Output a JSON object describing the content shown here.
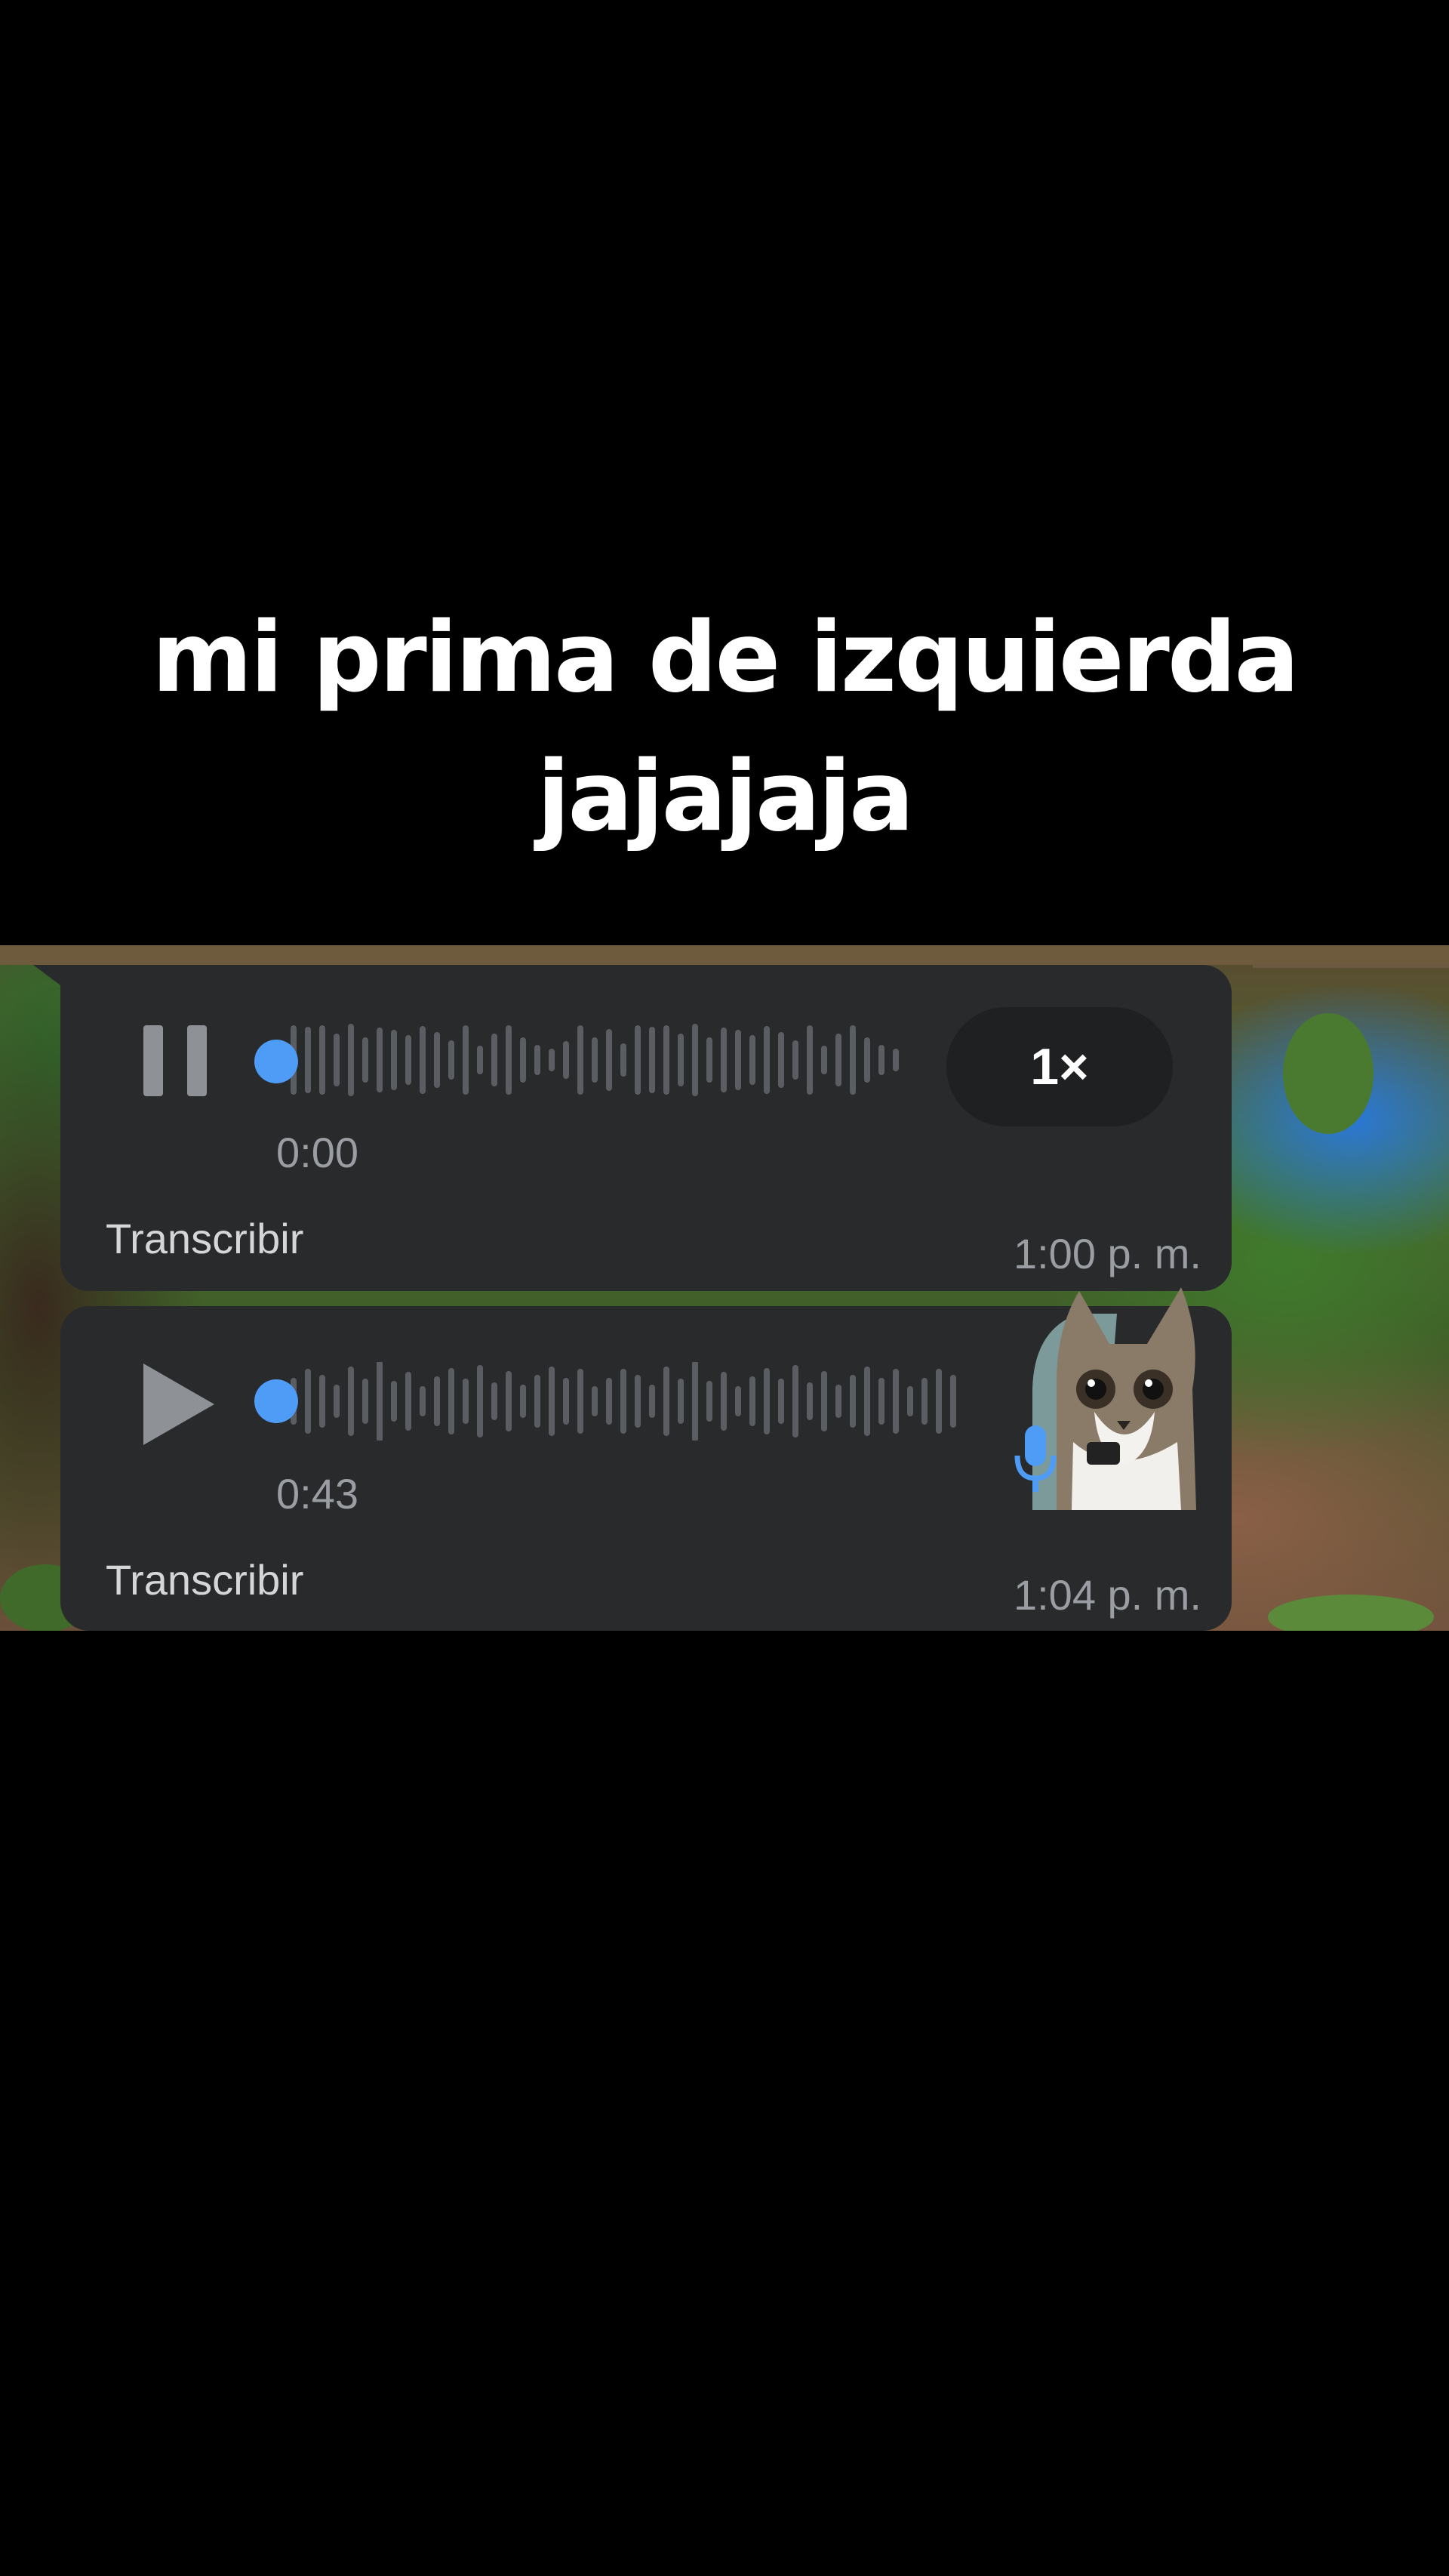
{
  "caption": {
    "line1": "mi prima de izquierda",
    "line2": "jajajaja"
  },
  "colors": {
    "accent_blue": "#4f9cf7",
    "bubble_bg": "#282a2c",
    "muted_text": "#9a9ea2"
  },
  "messages": [
    {
      "state": "playing",
      "control_icon": "pause-icon",
      "position": "0:00",
      "progress": 0,
      "speed": "1×",
      "transcribe_label": "Transcribir",
      "timestamp": "1:00 p. m."
    },
    {
      "state": "paused",
      "control_icon": "play-icon",
      "duration": "0:43",
      "progress": 0,
      "avatar": "cat-sticker-avatar",
      "mic_icon": "microphone-icon",
      "transcribe_label": "Transcribir",
      "timestamp": "1:04 p. m."
    }
  ]
}
